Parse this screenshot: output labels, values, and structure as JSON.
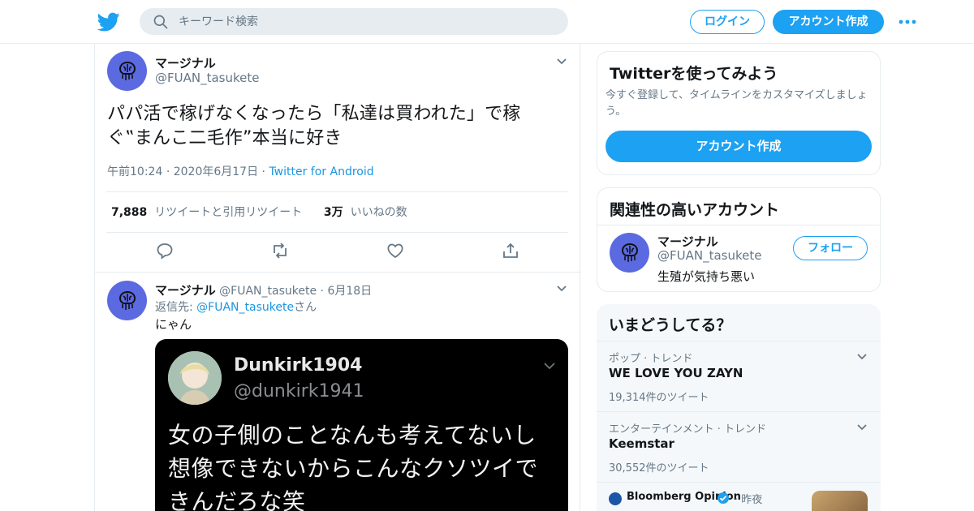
{
  "header": {
    "search_placeholder": "キーワード検索",
    "login_label": "ログイン",
    "signup_label": "アカウント作成"
  },
  "tweet": {
    "name": "マージナル",
    "handle": "@FUAN_tasukete",
    "text_line1": "パパ活で稼げなくなったら「私達は買われた」で稼",
    "text_line2": "ぐ‟まんこ二毛作”本当に好き",
    "time": "午前10:24",
    "date": "2020年6月17日",
    "source": "Twitter for Android",
    "retweets_count": "7,888",
    "retweets_label": "リツイートと引用リツイート",
    "likes_count": "3万",
    "likes_label": "いいねの数"
  },
  "reply": {
    "name": "マージナル",
    "handle": "@FUAN_tasukete",
    "date": "6月18日",
    "reply_prefix": "返信先: ",
    "reply_to": "@FUAN_tasukete",
    "reply_suffix": "さん",
    "text": "にゃん",
    "media": {
      "name": "Dunkirk1904",
      "handle": "@dunkirk1941",
      "text_line1": "女の子側のことなんも考えてないし",
      "text_line2": "想像できないからこんなクソツイで",
      "text_line3": "きんだろな笑"
    }
  },
  "sidebar": {
    "signup_card": {
      "title": "Twitterを使ってみよう",
      "description": "今すぐ登録して、タイムラインをカスタマイズしましょう。",
      "button": "アカウント作成"
    },
    "related_card": {
      "title": "関連性の高いアカウント",
      "name": "マージナル",
      "handle": "@FUAN_tasukete",
      "bio": "生殖が気持ち悪い",
      "follow": "フォロー"
    },
    "trends_card": {
      "title": "いまどうしてる？",
      "trends": [
        {
          "category": "ポップ · トレンド",
          "name": "WE LOVE YOU ZAYN",
          "count": "19,314件のツイート"
        },
        {
          "category": "エンターテインメント · トレンド",
          "name": "Keemstar",
          "count": "30,552件のツイート"
        }
      ],
      "news": {
        "source": "Bloomberg Opinion",
        "time": "昨夜"
      }
    }
  },
  "colors": {
    "accent": "#1da1f2",
    "link": "#1b95e0",
    "muted": "#657786",
    "avatar": "#5b6ae0"
  }
}
